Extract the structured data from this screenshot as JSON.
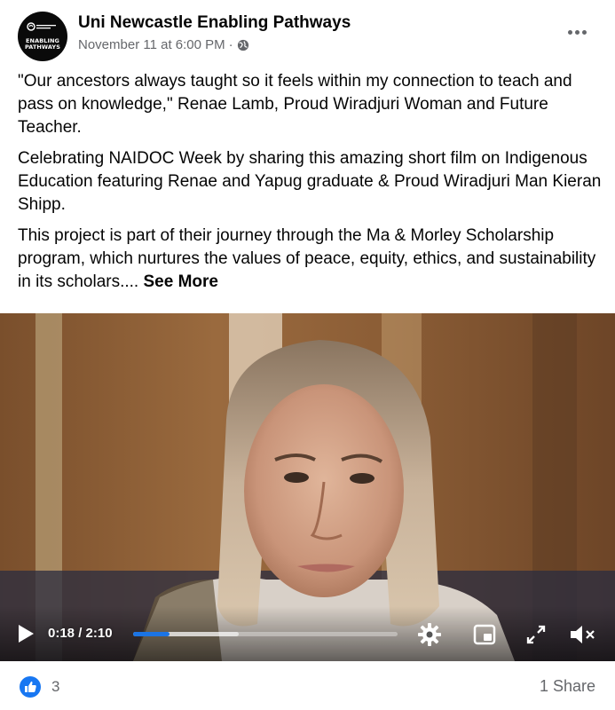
{
  "post": {
    "page_name": "Uni Newcastle Enabling Pathways",
    "timestamp": "November 11 at 6:00 PM",
    "separator": "·",
    "avatar_text_line1": "ENABLING",
    "avatar_text_line2": "PATHWAYS",
    "paragraphs": [
      "\"Our ancestors always taught so it feels within my connection to teach and pass on knowledge,\" Renae Lamb, Proud Wiradjuri Woman and Future Teacher.",
      "Celebrating NAIDOC Week by sharing this amazing short film on Indigenous Education featuring Renae and Yapug graduate & Proud Wiradjuri Man Kieran Shipp.",
      "This project is part of their journey through the Ma & Morley Scholarship program, which nurtures the values of peace, equity, ethics, and sustainability in its scholars.... "
    ],
    "see_more": "See More"
  },
  "video": {
    "time": "0:18 / 2:10",
    "played_fraction": 0.138,
    "buffered_fraction": 0.4
  },
  "footer": {
    "like_count": "3",
    "share_label": "1 Share"
  },
  "colors": {
    "accent": "#1877f2",
    "text_primary": "#050505",
    "text_secondary": "#65676b"
  }
}
